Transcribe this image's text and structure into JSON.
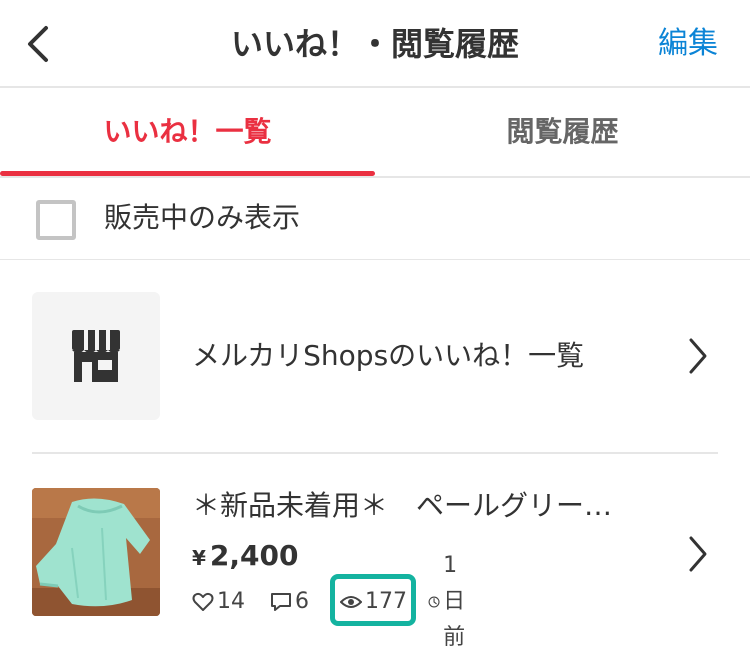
{
  "header": {
    "back_icon": "chevron-left-icon",
    "title": "いいね！・閲覧履歴",
    "edit_label": "編集",
    "edit_color": "#0b84d6"
  },
  "tabs": [
    {
      "label": "いいね！一覧",
      "active": true
    },
    {
      "label": "閲覧履歴",
      "active": false
    }
  ],
  "accent_color": "#ea3041",
  "filter": {
    "checkbox_checked": false,
    "label": "販売中のみ表示"
  },
  "shops_link": {
    "icon": "storefront-icon",
    "label": "メルカリShopsのいいね！一覧",
    "chevron_icon": "chevron-right-icon"
  },
  "items": [
    {
      "title": "＊新品未着用＊　ペールグリー…",
      "currency": "¥",
      "price": "2,400",
      "likes": "14",
      "comments": "6",
      "views": "177",
      "time": "1日前",
      "views_highlight_color": "#14b3a0"
    }
  ]
}
